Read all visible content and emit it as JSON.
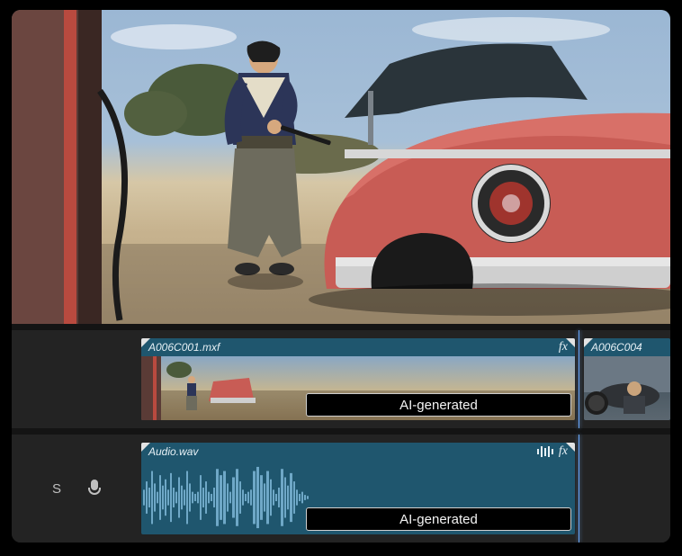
{
  "videoTrack": {
    "clipA": {
      "name": "A006C001.mxf",
      "fxLabel": "fx",
      "aiTag": "AI-generated"
    },
    "clipB": {
      "name": "A006C004"
    }
  },
  "audioTrack": {
    "sideLabel": "S",
    "clip": {
      "name": "Audio.wav",
      "fxLabel": "fx",
      "aiTag": "AI-generated"
    }
  }
}
